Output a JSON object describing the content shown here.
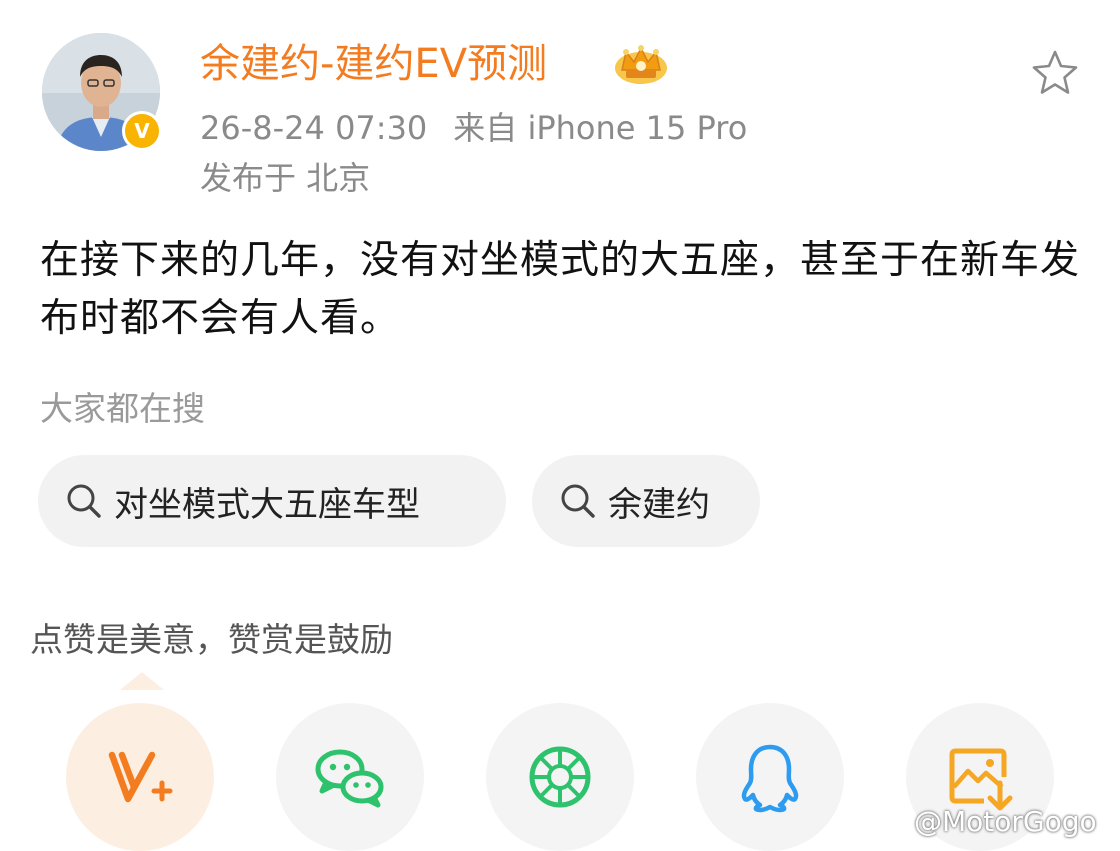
{
  "post": {
    "author": "余建约-建约EV预测",
    "timestamp": "26-8-24 07:30",
    "source": "来自 iPhone 15 Pro",
    "location": "发布于 北京",
    "content": "在接下来的几年，没有对坐模式的大五座，甚至于在新车发布时都不会有人看。",
    "badge": "V",
    "verified_badge_icon": "verified-v-icon",
    "rank_icon": "crown-icon",
    "favorite_icon": "star-icon"
  },
  "search": {
    "heading": "大家都在搜",
    "chips": [
      "对坐模式大五座车型",
      "余建约"
    ]
  },
  "reward": {
    "tip": "点赞是美意，赞赏是鼓励"
  },
  "share": {
    "items": [
      {
        "icon": "reward-v-plus-icon",
        "color": "#f47c20"
      },
      {
        "icon": "wechat-icon",
        "color": "#2dc26b"
      },
      {
        "icon": "moments-icon",
        "color": "#2dc26b"
      },
      {
        "icon": "qq-icon",
        "color": "#2d9cf0"
      },
      {
        "icon": "save-image-icon",
        "color": "#f5a623"
      }
    ]
  },
  "watermark": "@MotorGogo",
  "colors": {
    "accent": "#f47c20",
    "meta": "#8a8a8a",
    "chip_bg": "#f2f2f2"
  }
}
